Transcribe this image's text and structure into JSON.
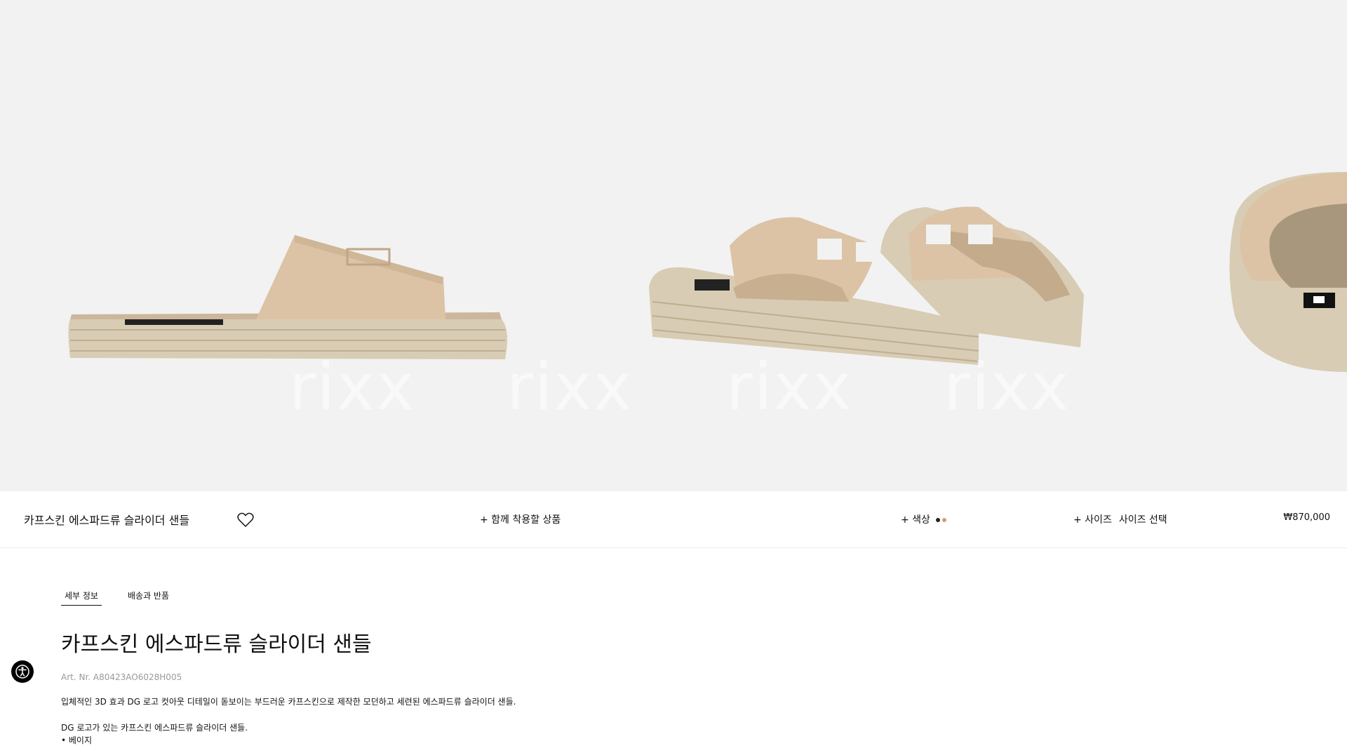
{
  "gallery": {
    "watermark": "rixx"
  },
  "product": {
    "title": "카프스킨 에스파드류 슬라이더 샌들",
    "together_label": "+ 함께 착용할 상품",
    "color_label": "+ 색상",
    "size_label": "+ 사이즈",
    "size_select": "사이즈 선택",
    "price": "₩870,000",
    "color_swatches": [
      "#222222",
      "#c9a27a"
    ]
  },
  "details": {
    "tabs": [
      "세부 정보",
      "배송과 반품"
    ],
    "heading": "카프스킨 에스파드류 슬라이더 샌들",
    "art_nr": "Art. Nr. A80423AO6028H005",
    "description": "입체적인 3D 효과 DG 로고 컷아웃 디테일이 돋보이는 부드러운 카프스킨으로 제작한 모던하고 세련된 에스파드류 슬라이더 샌들.",
    "bullet_intro": "DG 로고가 있는 카프스킨 에스파드류 슬라이더 샌들.",
    "bullet_1": "• 베이지"
  },
  "colors": {
    "background_gallery": "#f2f2f2",
    "leather": "#dcc3a6",
    "jute": "#d8ccb4"
  }
}
